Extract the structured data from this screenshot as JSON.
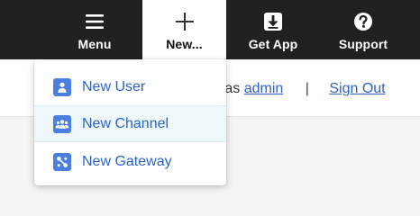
{
  "nav": {
    "menu": {
      "label": "Menu",
      "icon": "hamburger-icon"
    },
    "new": {
      "label": "New...",
      "icon": "plus-icon"
    },
    "get_app": {
      "label": "Get App",
      "icon": "download-icon"
    },
    "support": {
      "label": "Support",
      "icon": "help-icon"
    }
  },
  "status": {
    "prefix": "n as",
    "user": "admin",
    "separator": "|",
    "sign_out": "Sign Out"
  },
  "dropdown": {
    "items": [
      {
        "label": "New User",
        "icon": "user-icon"
      },
      {
        "label": "New Channel",
        "icon": "channel-group-icon",
        "highlighted": true
      },
      {
        "label": "New Gateway",
        "icon": "gateway-icon"
      }
    ]
  },
  "colors": {
    "topbar": "#1f2123",
    "link": "#2b63c9",
    "icon_accent": "#4a7fe0",
    "hover_row": "#eef8fb"
  }
}
